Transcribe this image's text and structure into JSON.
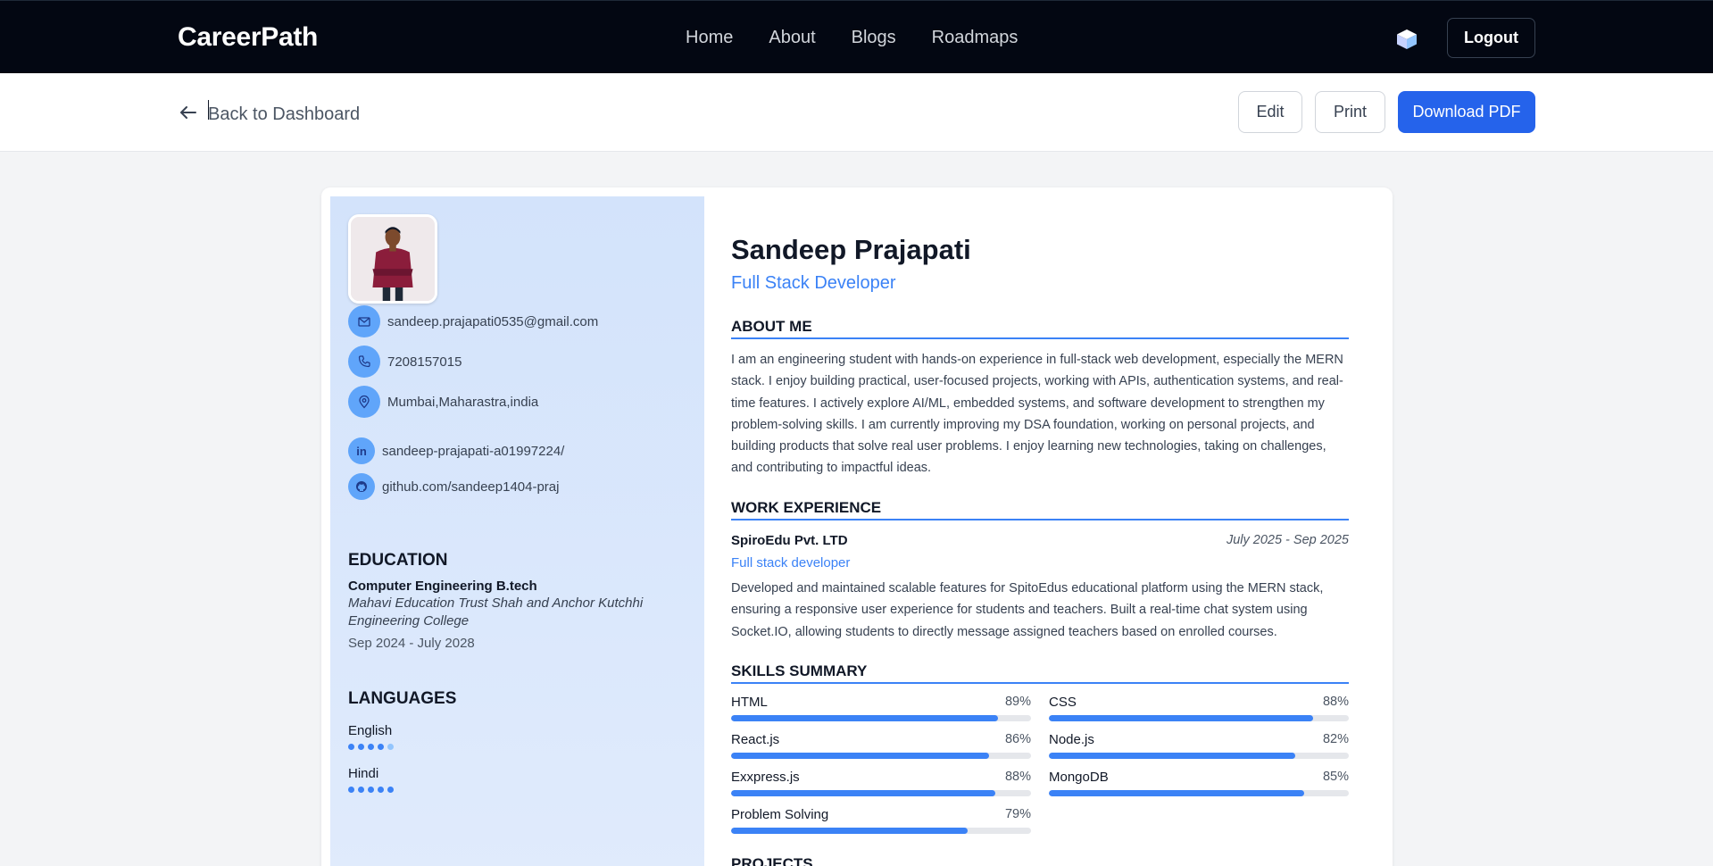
{
  "nav": {
    "brand": "CareerPath",
    "links": [
      "Home",
      "About",
      "Blogs",
      "Roadmaps"
    ],
    "logout_label": "Logout"
  },
  "toolbar": {
    "back_label": "Back to Dashboard",
    "edit_label": "Edit",
    "print_label": "Print",
    "download_label": "Download PDF"
  },
  "resume": {
    "name": "Sandeep Prajapati",
    "role": "Full Stack Developer",
    "contact": {
      "email": "sandeep.prajapati0535@gmail.com",
      "phone": "7208157015",
      "location": "Mumbai,Maharastra,india",
      "linkedin": "sandeep-prajapati-a01997224/",
      "github": "github.com/sandeep1404-praj"
    },
    "education_heading": "EDUCATION",
    "education": {
      "degree": "Computer Engineering B.tech",
      "school": "Mahavi Education Trust Shah and Anchor Kutchhi Engineering College",
      "dates": "Sep 2024 - July 2028"
    },
    "languages_heading": "LANGUAGES",
    "languages": [
      {
        "name": "English",
        "level": 4,
        "max": 5
      },
      {
        "name": "Hindi",
        "level": 5,
        "max": 5
      }
    ],
    "about_heading": "ABOUT ME",
    "about": "I am an engineering student with hands-on experience in full-stack web development, especially the MERN stack. I enjoy building practical, user-focused projects, working with APIs, authentication systems, and real-time features. I actively explore AI/ML, embedded systems, and software development to strengthen my problem-solving skills. I am currently improving my DSA foundation, working on personal projects, and building products that solve real user problems. I enjoy learning new technologies, taking on challenges, and contributing to impactful ideas.",
    "work_heading": "WORK EXPERIENCE",
    "work": {
      "company": "SpiroEdu Pvt. LTD",
      "dates": "July 2025 - Sep 2025",
      "title": "Full stack developer",
      "description": "Developed and maintained scalable features for SpitoEdus educational platform using the MERN stack, ensuring a responsive user experience for students and teachers. Built a real-time chat system using Socket.IO, allowing students to directly message assigned teachers based on enrolled courses."
    },
    "skills_heading": "SKILLS SUMMARY",
    "skills": [
      {
        "name": "HTML",
        "pct_label": "89%",
        "value": 89
      },
      {
        "name": "CSS",
        "pct_label": "88%",
        "value": 88
      },
      {
        "name": "React.js",
        "pct_label": "86%",
        "value": 86
      },
      {
        "name": "Node.js",
        "pct_label": "82%",
        "value": 82
      },
      {
        "name": "Exxpress.js",
        "pct_label": "88%",
        "value": 88
      },
      {
        "name": "MongoDB",
        "pct_label": "85%",
        "value": 85
      },
      {
        "name": "Problem Solving",
        "pct_label": "79%",
        "value": 79
      }
    ],
    "projects_heading": "PROJECTS"
  },
  "colors": {
    "accent": "#3b82f6",
    "primary_button": "#2563eb",
    "navbar": "#030712"
  }
}
